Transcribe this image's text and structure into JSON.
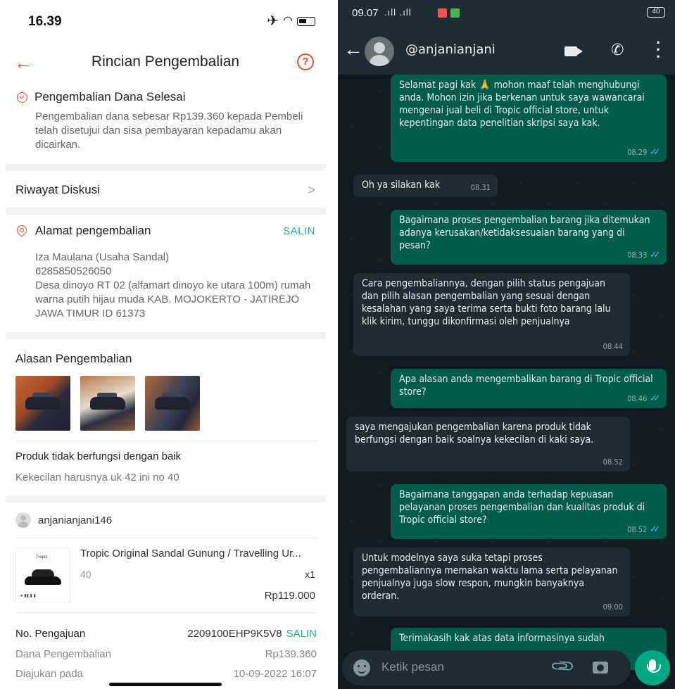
{
  "left": {
    "status_bar": {
      "time": "16.39"
    },
    "nav": {
      "title": "Rincian Pengembalian",
      "help_icon": "?"
    },
    "refund_status": {
      "title": "Pengembalian Dana Selesai",
      "body": "Pengembalian dana sebesar Rp139.360 kepada Pembeli telah disetujui dan sisa pembayaran kepadamu akan dicairkan."
    },
    "discussion_history": {
      "label": "Riwayat Diskusi",
      "chevron": ">"
    },
    "return_address": {
      "title": "Alamat pengembalian",
      "copy_label": "SALIN",
      "lines": [
        "Iza Maulana (Usaha Sandal)",
        "6285850526050",
        "Desa dinoyo RT 02 (alfamart dinoyo ke utara 100m) rumah warna putih hijau muda KAB. MOJOKERTO - JATIREJO JAWA TIMUR ID 61373"
      ]
    },
    "return_reason": {
      "title": "Alasan Pengembalian",
      "reason": "Produk tidak berfungsi dengan baik",
      "note": "Kekecilan harusnya uk 42 ini no 40"
    },
    "buyer": {
      "username": "anjanianjani146"
    },
    "product": {
      "name": "Tropic Original Sandal Gunung / Travelling Ur...",
      "variant": "40",
      "qty": "x1",
      "price": "Rp119.000"
    },
    "details": {
      "submission_no_label": "No. Pengajuan",
      "submission_no": "2209100EHP9K5V8",
      "copy_label": "SALIN",
      "refund_amount_label": "Dana Pengembalian",
      "refund_amount": "Rp139.360",
      "submitted_at_label": "Diajukan pada",
      "submitted_at": "10-09-2022 16:07"
    }
  },
  "right": {
    "status_bar": {
      "time": "09.07",
      "signal": ".ıll .ıll",
      "battery": "40"
    },
    "header": {
      "contact": "@anjanianjani"
    },
    "messages": [
      {
        "dir": "out",
        "text": "Selamat pagi kak 🙏 mohon maaf telah menghubungi anda. Mohon izin jika berkenan untuk saya wawancarai mengenai jual beli di Tropic official store, untuk kepentingan data penelitian skripsi saya kak.",
        "time": "08.29"
      },
      {
        "dir": "in",
        "text": "Oh ya silakan kak",
        "time": "08.31"
      },
      {
        "dir": "out",
        "text": "Bagaimana proses pengembalian barang jika ditemukan adanya kerusakan/ketidaksesuaian barang yang di pesan?",
        "time": "08.33"
      },
      {
        "dir": "in",
        "text": "Cara pengembaliannya, dengan pilih status pengajuan dan pilih alasan pengembalian yang sesuai dengan kesalahan yang saya terima serta bukti foto barang lalu klik kirim, tunggu dikonfirmasi oleh penjualnya",
        "time": "08.44"
      },
      {
        "dir": "out",
        "text": "Apa alasan anda mengembalikan barang di Tropic official store?",
        "time": "08.46"
      },
      {
        "dir": "in",
        "text": "saya mengajukan pengembalian karena produk tidak berfungsi dengan baik soalnya kekecilan di kaki saya.",
        "time": "08.52"
      },
      {
        "dir": "out",
        "text": "Bagaimana tanggapan anda terhadap kepuasan pelayanan proses pengembalian dan kualitas produk di Tropic official store?",
        "time": "08.52"
      },
      {
        "dir": "in",
        "text": "Untuk modelnya saya suka tetapi proses pengembaliannya memakan waktu lama serta pelayanan penjualnya juga slow respon, mungkin banyaknya orderan.",
        "time": "09.00"
      },
      {
        "dir": "out",
        "text": "Terimakasih kak atas data informasinya sudah",
        "time": ""
      }
    ],
    "input": {
      "placeholder": "Ketik pesan"
    }
  },
  "colors": {
    "shopee_accent": "#ee4d2d",
    "copy_green": "#26aa99",
    "wa_out": "#005c4b",
    "wa_in": "#202c33",
    "wa_accent": "#00a884"
  }
}
